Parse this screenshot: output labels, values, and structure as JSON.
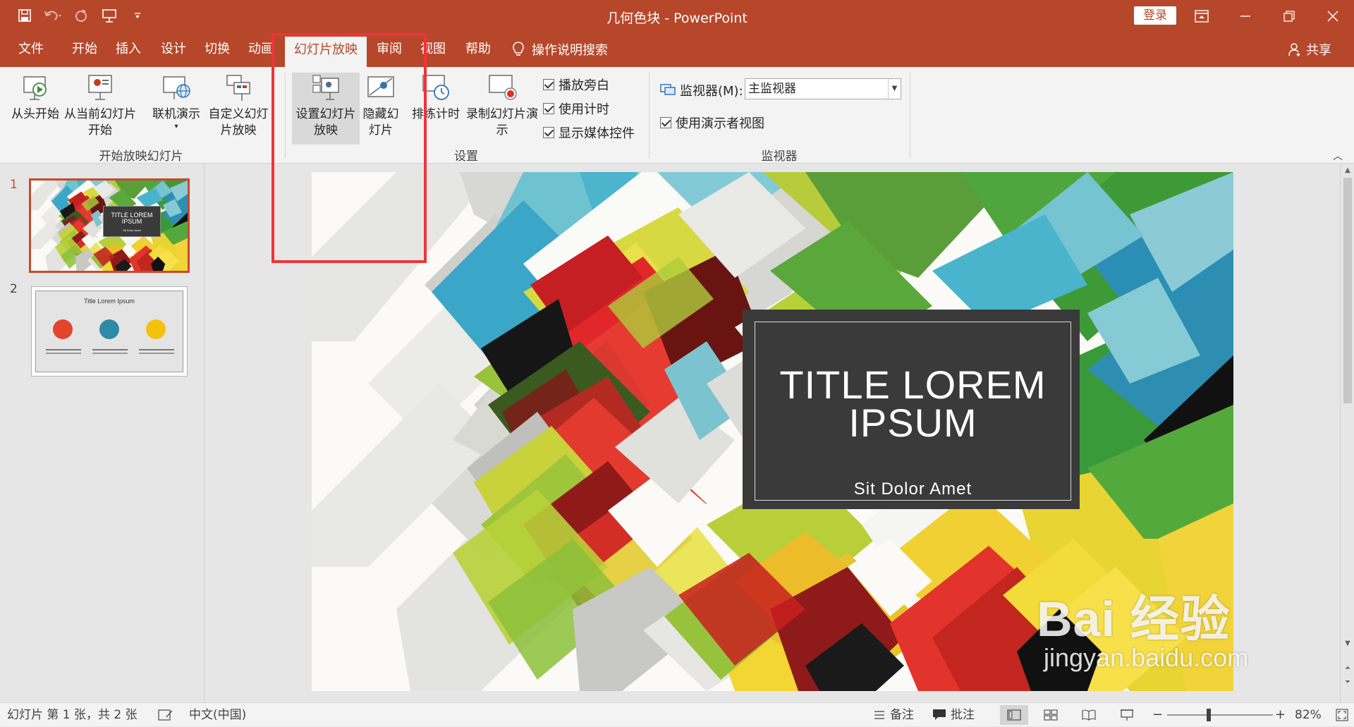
{
  "window": {
    "title": "几何色块  -  PowerPoint",
    "login_label": "登录"
  },
  "tabs": [
    {
      "label": "文件"
    },
    {
      "label": "开始"
    },
    {
      "label": "插入"
    },
    {
      "label": "设计"
    },
    {
      "label": "切换"
    },
    {
      "label": "动画"
    },
    {
      "label": "幻灯片放映",
      "active": true
    },
    {
      "label": "审阅"
    },
    {
      "label": "视图"
    },
    {
      "label": "帮助"
    }
  ],
  "tell_me": "操作说明搜索",
  "share_label": "共享",
  "ribbon": {
    "start_group": {
      "label": "开始放映幻灯片",
      "from_beginning": "从头开始",
      "from_current": "从当前幻灯片开始",
      "online_present": "联机演示",
      "custom_show": "自定义幻灯片放映"
    },
    "setup_group": {
      "label": "设置",
      "setup_show": "设置幻灯片放映",
      "hide_slide": "隐藏幻灯片",
      "rehearse": "排练计时",
      "record": "录制幻灯片演示",
      "play_narration": "播放旁白",
      "use_timings": "使用计时",
      "show_media_controls": "显示媒体控件"
    },
    "monitor_group": {
      "label": "监视器",
      "monitor_label": "监视器(M):",
      "monitor_value": "主监视器",
      "presenter_view": "使用演示者视图"
    }
  },
  "thumbnails": [
    {
      "number": "1",
      "title": "TITLE LOREM IPSUM",
      "subtitle": "Sit Dolor Amet"
    },
    {
      "number": "2",
      "title": "Title Lorem Ipsum"
    }
  ],
  "slide": {
    "title_line1": "TITLE LOREM",
    "title_line2": "IPSUM",
    "subtitle": "Sit Dolor Amet"
  },
  "watermark": {
    "brand": "Bai 经验",
    "url": "jingyan.baidu.com"
  },
  "status": {
    "slide_info": "幻灯片 第 1 张，共 2 张",
    "language": "中文(中国)",
    "notes": "备注",
    "comments": "批注",
    "zoom": "82%"
  }
}
